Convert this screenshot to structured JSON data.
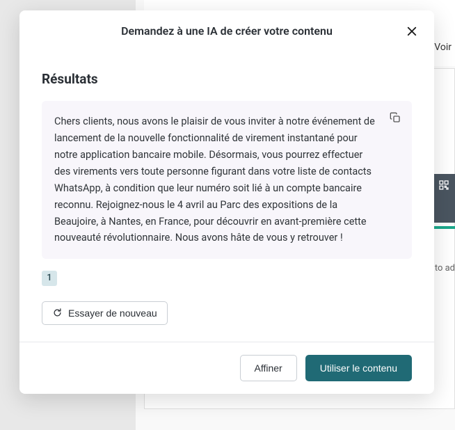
{
  "modal": {
    "title": "Demandez à une IA de créer votre contenu",
    "section_title": "Résultats",
    "result_text": "Chers clients, nous avons le plaisir de vous inviter à notre événement de lancement de la nouvelle fonctionnalité de virement instantané pour notre application bancaire mobile. Désormais, vous pourrez effectuer des virements vers toute personne figurant dans votre liste de contacts WhatsApp, à condition que leur numéro soit lié à un compte bancaire reconnu. Rejoignez-nous le 4 avril au Parc des expositions de la Beaujoire, à Nantes, en France, pour découvrir en avant-première cette nouveauté révolutionnaire. Nous avons hâte de vous y retrouver !",
    "page_number": "1",
    "retry_label": "Essayer de nouveau",
    "refine_label": "Affiner",
    "use_content_label": "Utiliser le contenu"
  },
  "background": {
    "voir_label": "Voir",
    "to_ad_label": "to ad"
  }
}
